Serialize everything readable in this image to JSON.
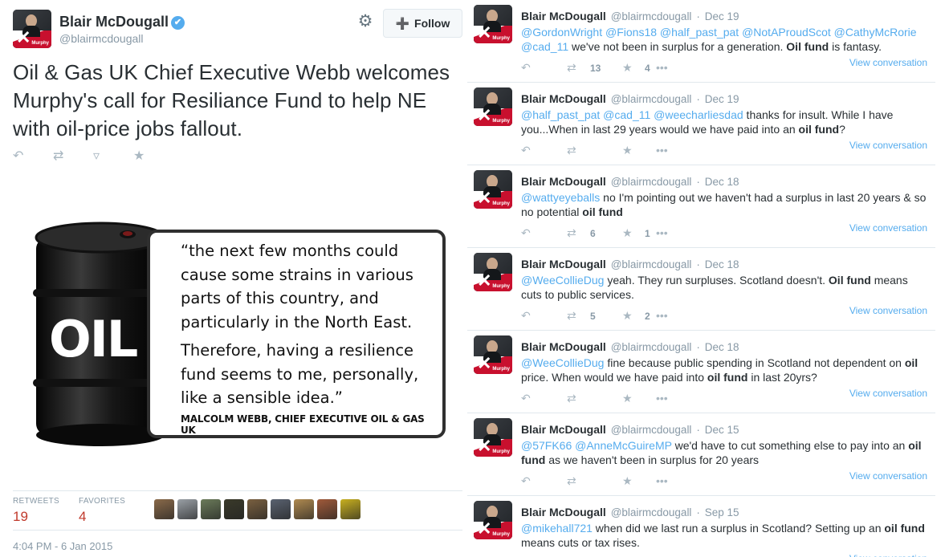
{
  "main_tweet": {
    "display_name": "Blair McDougall",
    "handle": "@blairmcdougall",
    "follow_label": "Follow",
    "text": "Oil & Gas UK Chief Executive Webb welcomes Murphy's call for Resiliance Fund to help NE with oil-price jobs fallout.",
    "image": {
      "barrel_label": "OIL",
      "quote_lines": [
        "“the next few months could cause some strains in various parts of this country, and particularly in the North East.",
        "Therefore, having a resilience fund seems to me, personally, like a sensible idea.”"
      ],
      "attribution": "MALCOLM WEBB, CHIEF EXECUTIVE OIL & GAS UK"
    },
    "stats": {
      "retweets_label": "RETWEETS",
      "retweets": "19",
      "favorites_label": "FAVORITES",
      "favorites": "4"
    },
    "timestamp": "4:04 PM - 6 Jan 2015"
  },
  "avatar_text": "Murphy",
  "timeline": [
    {
      "name": "Blair McDougall",
      "handle": "@blairmcdougall",
      "date": "Dec 19",
      "segments": [
        {
          "t": "@GordonWright @Fions18 @half_past_pat @NotAProudScot @CathyMcRorie @cad_11",
          "k": "m"
        },
        {
          "t": " we've not been in surplus for a generation. ",
          "k": "n"
        },
        {
          "t": "Oil fund",
          "k": "b"
        },
        {
          "t": " is fantasy.",
          "k": "n"
        }
      ],
      "retweets": "13",
      "favorites": "4",
      "view": "View conversation"
    },
    {
      "name": "Blair McDougall",
      "handle": "@blairmcdougall",
      "date": "Dec 19",
      "segments": [
        {
          "t": "@half_past_pat @cad_11 @weecharliesdad",
          "k": "m"
        },
        {
          "t": " thanks for insult. While I have you...When in last 29 years would we have paid into an ",
          "k": "n"
        },
        {
          "t": "oil fund",
          "k": "b"
        },
        {
          "t": "?",
          "k": "n"
        }
      ],
      "retweets": "",
      "favorites": "",
      "view": "View conversation"
    },
    {
      "name": "Blair McDougall",
      "handle": "@blairmcdougall",
      "date": "Dec 18",
      "segments": [
        {
          "t": "@wattyeyeballs",
          "k": "m"
        },
        {
          "t": " no I'm pointing out we haven't had a surplus in last 20 years & so no potential ",
          "k": "n"
        },
        {
          "t": "oil fund",
          "k": "b"
        }
      ],
      "retweets": "6",
      "favorites": "1",
      "view": "View conversation"
    },
    {
      "name": "Blair McDougall",
      "handle": "@blairmcdougall",
      "date": "Dec 18",
      "segments": [
        {
          "t": "@WeeCollieDug",
          "k": "m"
        },
        {
          "t": " yeah. They run surpluses. Scotland doesn't. ",
          "k": "n"
        },
        {
          "t": "Oil fund",
          "k": "b"
        },
        {
          "t": " means cuts to public services.",
          "k": "n"
        }
      ],
      "retweets": "5",
      "favorites": "2",
      "view": "View conversation"
    },
    {
      "name": "Blair McDougall",
      "handle": "@blairmcdougall",
      "date": "Dec 18",
      "segments": [
        {
          "t": "@WeeCollieDug",
          "k": "m"
        },
        {
          "t": " fine because public spending in Scotland not dependent on ",
          "k": "n"
        },
        {
          "t": "oil",
          "k": "b"
        },
        {
          "t": " price. When would we have paid into ",
          "k": "n"
        },
        {
          "t": "oil fund",
          "k": "b"
        },
        {
          "t": " in last 20yrs?",
          "k": "n"
        }
      ],
      "retweets": "",
      "favorites": "",
      "view": "View conversation"
    },
    {
      "name": "Blair McDougall",
      "handle": "@blairmcdougall",
      "date": "Dec 15",
      "segments": [
        {
          "t": "@57FK66 @AnneMcGuireMP",
          "k": "m"
        },
        {
          "t": " we'd have to cut something else to pay into an ",
          "k": "n"
        },
        {
          "t": "oil fund",
          "k": "b"
        },
        {
          "t": " as we haven't been in surplus for 20 years",
          "k": "n"
        }
      ],
      "retweets": "",
      "favorites": "",
      "view": "View conversation"
    },
    {
      "name": "Blair McDougall",
      "handle": "@blairmcdougall",
      "date": "Sep 15",
      "segments": [
        {
          "t": "@mikehall721",
          "k": "m"
        },
        {
          "t": " when did we last run a surplus in Scotland? Setting up an ",
          "k": "n"
        },
        {
          "t": "oil fund",
          "k": "b"
        },
        {
          "t": " means cuts or tax rises.",
          "k": "n"
        }
      ],
      "retweets": "",
      "favorites": "",
      "view": "View conversation"
    }
  ],
  "colors": {
    "link": "#55acee",
    "stat_value": "#c0392b",
    "muted": "#8899a6",
    "action_icon": "#aab8c2"
  },
  "icons": {
    "reply": "↶",
    "retweet": "⇄",
    "favorite": "★",
    "more": "•••",
    "pocket": "▿",
    "gear": "⚙",
    "follow": "➕",
    "verified": "✔"
  },
  "favoriter_faces": [
    "#8a6a4a",
    "#9aa0a6",
    "#6b7b5a",
    "#3a3a2a",
    "#7a6040",
    "#5a6270",
    "#b08a50",
    "#a05a3a",
    "#c8b020"
  ]
}
